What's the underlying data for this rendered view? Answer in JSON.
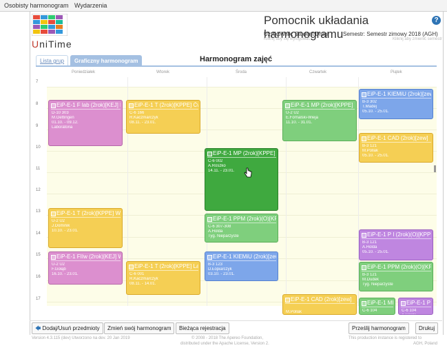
{
  "menu": {
    "items": [
      "Osobisty harmonogram",
      "Wydarzenia"
    ]
  },
  "header": {
    "logo_text_first": "U",
    "logo_text_rest": "niTime",
    "title": "Pomocnik układania harmonogramu",
    "help_symbol": "?",
    "user_label": "Użytkownik: Student Drugi",
    "user_sub": "Kliknij aby się wylogować",
    "session_label": "Semestr: Semestr zimowy 2018 (AGH)",
    "session_sub": "Kliknij aby zmienić semestr"
  },
  "tabs": {
    "list": "Lista grup",
    "graphic": "Graficzny harmonogram"
  },
  "schedule": {
    "title": "Harmonogram zajęć",
    "days": [
      "Poniedziałek",
      "Wtorek",
      "Środa",
      "Czwartek",
      "Piątek"
    ],
    "hours": [
      "7",
      "8",
      "9",
      "10",
      "11",
      "12",
      "13",
      "14",
      "15",
      "16",
      "17"
    ],
    "events": [
      {
        "title": "EiP-E-1 F lab (2rok)[KEJ] Lab",
        "lines": [
          "D-10 303",
          "M.Oettingen",
          "01.10. - 09.12.",
          "Laboratoria"
        ],
        "color": "pink"
      },
      {
        "title": "EiP-E-1 T (2rok)[KPPE] Ćw",
        "lines": [
          "C-6 166",
          "R.Kaczmarczyk",
          "08.11. - 23.01."
        ],
        "color": "orange"
      },
      {
        "title": "EiP-E-1 MP (2rok)[KPPE] Wyk",
        "lines": [
          "U-2 U2",
          "E.Fornalski-Wieja",
          "11.10. - 31.01."
        ],
        "color": "green"
      },
      {
        "title": "EiP-E-1 KIEMiU (2rok)[zew]",
        "lines": [
          "B-3 302",
          "T.Madej",
          "05.10. - 25.01."
        ],
        "color": "blue"
      },
      {
        "title": "EiP-E-1 CAD (2rok)[zew]",
        "lines": [
          "B-3 121",
          "M.Pollak",
          "05.10. - 25.01."
        ],
        "color": "orange"
      },
      {
        "title": "EiP-E-1 MP (2rok)[KPPE] Lab",
        "lines": [
          "C-6 002",
          "A.Roszko",
          "14.11. - 23.01."
        ],
        "color": "dgreen"
      },
      {
        "title": "EiP-E-1 T (2rok)[KPPE] Wyk",
        "lines": [
          "U-2 U2",
          "J.Dominik",
          "10.10. - 23.01."
        ],
        "color": "orange"
      },
      {
        "title": "EiP-E-1 PPM (2rok)(O)[KPPE]",
        "lines": [
          "C-6 307-308",
          "A.Holda",
          "Tyg. Nieparzyste"
        ],
        "color": "green"
      },
      {
        "title": "EiP-E-1 P I (2rok)(O)[KPPE]",
        "lines": [
          "B-3 121",
          "A.Holda",
          "05.10. - 25.01."
        ],
        "color": "purple"
      },
      {
        "title": "EiP-E-1 FIIw (2rok)[KEJ] Wyk",
        "lines": [
          "U-2 U2",
          "F.Gołąb",
          "16.10. - 23.01."
        ],
        "color": "pink"
      },
      {
        "title": "EiP-E-1 T (2rok)[KPPE] Lab",
        "lines": [
          "C-6 001",
          "R.Kaczmarczyk",
          "08.11. - 14.01."
        ],
        "color": "orange"
      },
      {
        "title": "EiP-E-1 KIEMiU (2rok)[zew]",
        "lines": [
          "B-3 123",
          "D.Łopiarczyk",
          "03.10. - 23.01."
        ],
        "color": "blue"
      },
      {
        "title": "EiP-E-1 PPM (2rok)(O)[KPPE]",
        "lines": [
          "B-3 121",
          "M.Dudek",
          "Tyg. Nieparzyste"
        ],
        "color": "green"
      },
      {
        "title": "EiP-E-1 CAD (2rok)[zew]",
        "lines": [
          "",
          "M.Pollak"
        ],
        "color": "orange"
      },
      {
        "title": "EiP-E-1 MP",
        "lines": [
          "C-6 104"
        ],
        "color": "green"
      },
      {
        "title": "EiP-E-1 P I",
        "lines": [
          "C-6 104",
          "A.Holda"
        ],
        "color": "purple"
      }
    ]
  },
  "buttons": {
    "add_remove": "Dodaj/Usuń przedmioty",
    "change_schedule": "Zmień swój harmonogram",
    "current_registration": "Bieżąca rejestracja",
    "send": "Prześlij harmonogram",
    "print": "Drukuj"
  },
  "footer": {
    "version": "Version 4.3.115 (dev) Utworzono na dev. 20 Jan 2019",
    "copyright_line1": "© 2008 - 2018 The Apereo Foundation,",
    "copyright_line2": "distributed under the Apache License, Version 2.",
    "notice_line1": "This production instance is registered to",
    "notice_line2": "AGH, Poland"
  }
}
